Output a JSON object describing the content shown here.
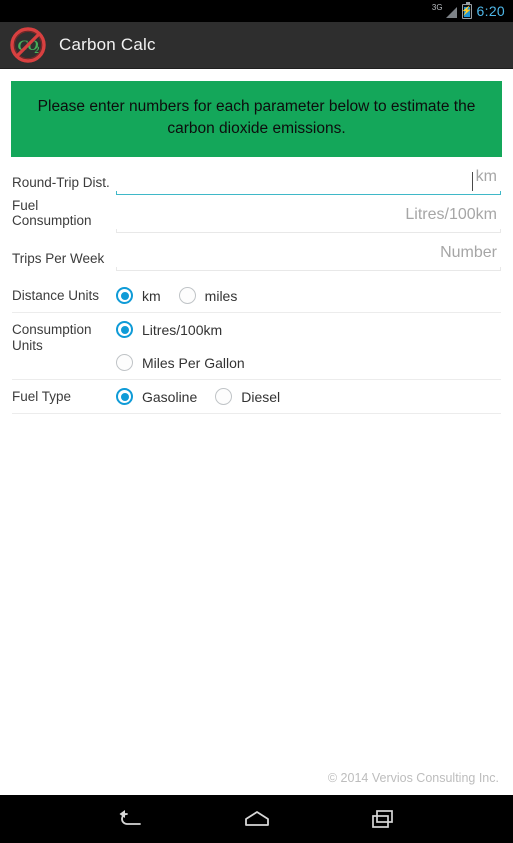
{
  "status_bar": {
    "network_label": "3G",
    "signal_icon": "signal-bars-icon",
    "battery_icon": "battery-charging-icon",
    "time": "6:20",
    "time_color": "#4fb7e8"
  },
  "action_bar": {
    "logo_icon": "co2-prohibited-logo-icon",
    "logo_text": "CO",
    "logo_subscript": "2",
    "title": "Carbon Calc",
    "background_color": "#2e2e2e"
  },
  "banner": {
    "text": "Please enter numbers for each parameter below to estimate the carbon dioxide emissions.",
    "background_color": "#14a75a",
    "text_color": "#0d0d0d"
  },
  "form": {
    "fields": [
      {
        "label": "Round-Trip Dist.",
        "value": "",
        "placeholder": "km",
        "focused": true
      },
      {
        "label": "Fuel Consumption",
        "value": "",
        "placeholder": "Litres/100km",
        "focused": false
      },
      {
        "label": "Trips Per Week",
        "value": "",
        "placeholder": "Number",
        "focused": false
      }
    ],
    "radio_groups": [
      {
        "label": "Distance Units",
        "layout": "inline",
        "options": [
          {
            "label": "km",
            "selected": true
          },
          {
            "label": "miles",
            "selected": false
          }
        ]
      },
      {
        "label": "Consumption Units",
        "layout": "stacked",
        "options": [
          {
            "label": "Litres/100km",
            "selected": true
          },
          {
            "label": "Miles Per Gallon",
            "selected": false
          }
        ]
      },
      {
        "label": "Fuel Type",
        "layout": "inline",
        "options": [
          {
            "label": "Gasoline",
            "selected": true
          },
          {
            "label": "Diesel",
            "selected": false
          }
        ]
      }
    ],
    "accent_color": "#0f9bd7",
    "focus_underline_color": "#3fb8c8"
  },
  "footer": {
    "copyright": "© 2014 Vervios Consulting Inc."
  },
  "nav_bar": {
    "buttons": [
      {
        "name": "back-icon",
        "label": "Back"
      },
      {
        "name": "home-icon",
        "label": "Home"
      },
      {
        "name": "recents-icon",
        "label": "Recent apps"
      }
    ]
  }
}
